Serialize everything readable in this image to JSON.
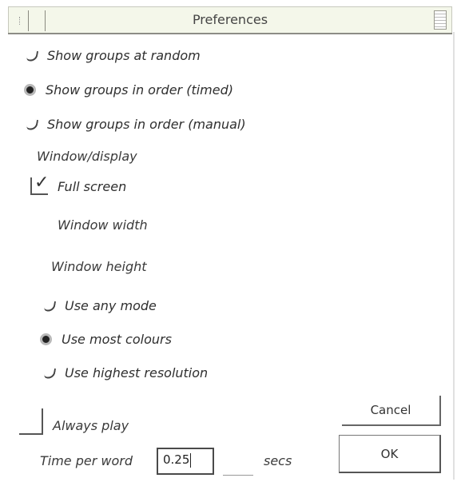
{
  "window": {
    "title": "Preferences"
  },
  "group_mode": {
    "options": [
      {
        "label": "Show groups at random",
        "selected": false
      },
      {
        "label": "Show groups in order (timed)",
        "selected": true
      },
      {
        "label": "Show groups in order (manual)",
        "selected": false
      }
    ]
  },
  "display": {
    "section_label": "Window/display",
    "full_screen": {
      "label": "Full screen",
      "checked": true,
      "mark": "✓"
    },
    "window_width_label": "Window width",
    "window_height_label": "Window height",
    "modes": [
      {
        "label": "Use any mode",
        "selected": false
      },
      {
        "label": "Use most colours",
        "selected": true
      },
      {
        "label": "Use highest resolution",
        "selected": false
      }
    ]
  },
  "always_play": {
    "label": "Always play",
    "checked": false
  },
  "time_per_word": {
    "label": "Time per word",
    "value": "0.25",
    "unit": "secs"
  },
  "buttons": {
    "cancel": "Cancel",
    "ok": "OK"
  }
}
